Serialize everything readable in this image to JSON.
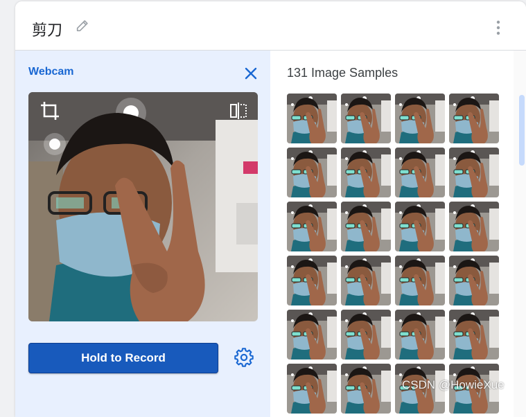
{
  "header": {
    "class_name": "剪刀",
    "edit_icon": "pencil-icon",
    "menu_icon": "more-vert-icon"
  },
  "webcam": {
    "title": "Webcam",
    "close_icon": "close-icon",
    "crop_icon": "crop-icon",
    "flip_icon": "flip-icon",
    "record_label": "Hold to Record",
    "settings_icon": "gear-icon"
  },
  "samples": {
    "title": "131 Image Samples",
    "visible_count": 24
  },
  "watermark": "CSDN @HowieXue",
  "colors": {
    "accent": "#1967d2",
    "record_button": "#185abc",
    "panel_bg": "#e8f0fe"
  }
}
